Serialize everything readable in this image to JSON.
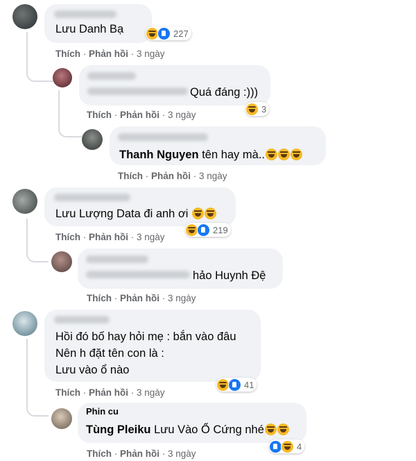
{
  "actions": {
    "like": "Thích",
    "reply": "Phản hồi",
    "time": "3 ngày"
  },
  "comments": [
    {
      "text": "Lưu Danh Bạ",
      "reaction_count": "227"
    },
    {
      "text": "Quá đáng :)))",
      "reaction_count": "3"
    },
    {
      "name": "Thanh Nguyen",
      "text": "tên hay mà.."
    },
    {
      "text": "Lưu Lượng Data đi anh ơi",
      "reaction_count": "219"
    },
    {
      "text": "hảo Huynh Đệ"
    },
    {
      "lines": [
        "Hồi đó bố hay hỏi mẹ : bắn vào đâu",
        "Nên h đặt tên con là :",
        "Lưu vào ổ nào"
      ],
      "reaction_count": "41"
    },
    {
      "partial_top": "Phin cu",
      "name": "Tùng Pleiku",
      "text": "Lưu Vào Ổ Cứng nhé",
      "reaction_count": "4"
    }
  ],
  "colors": {
    "bubble": "#f0f2f5",
    "meta": "#65676b",
    "haha": "#f7b928",
    "like": "#1877f2"
  }
}
